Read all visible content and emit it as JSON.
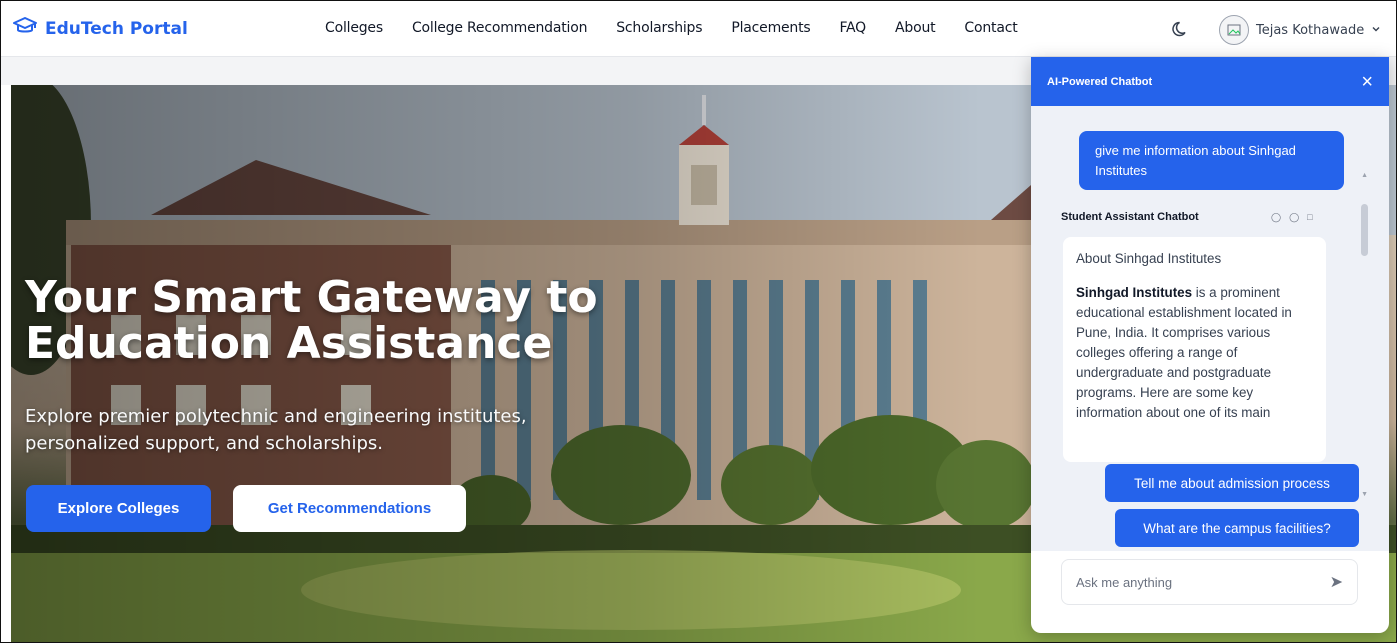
{
  "brand": {
    "name": "EduTech Portal",
    "icon": "graduation-cap-icon",
    "color": "#2563eb"
  },
  "nav": {
    "items": [
      "Colleges",
      "College Recommendation",
      "Scholarships",
      "Placements",
      "FAQ",
      "About",
      "Contact"
    ]
  },
  "header": {
    "theme_icon": "moon-icon",
    "user_name": "Tejas Kothawade",
    "dropdown_icon": "chevron-down-icon"
  },
  "hero": {
    "title": "Your Smart Gateway to Education Assistance",
    "subtitle": "Explore premier polytechnic and engineering institutes, personalized support, and scholarships.",
    "primary_button": "Explore Colleges",
    "secondary_button": "Get Recommendations"
  },
  "chatbot": {
    "title": "AI-Powered Chatbot",
    "close": "×",
    "user_message": "give me information about Sinhgad Institutes",
    "bot_name": "Student Assistant Chatbot",
    "bot_heading": "About Sinhgad Institutes",
    "bot_bold": "Sinhgad Institutes",
    "bot_text": " is a prominent educational establishment located in Pune, India. It comprises various colleges offering a range of undergraduate and postgraduate programs. Here are some key information about one of its main",
    "suggestions": [
      "Tell me about admission process",
      "What are the campus facilities?"
    ],
    "input_placeholder": "Ask me anything",
    "send_icon": "send-icon",
    "accent": "#2563eb"
  }
}
